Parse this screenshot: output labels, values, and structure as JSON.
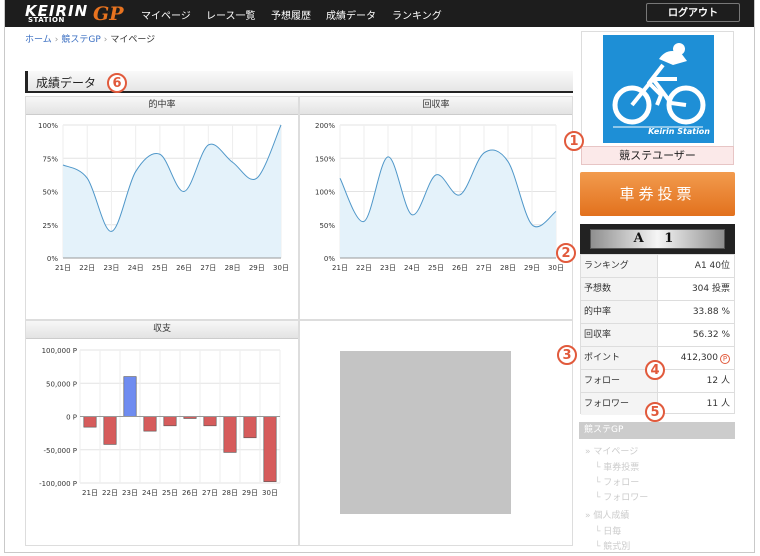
{
  "nav": {
    "logo_keirin": "KEIRIN",
    "logo_station": "STATION",
    "logo_gp": "GP",
    "items": [
      "マイページ",
      "レース一覧",
      "予想履歴",
      "成績データ",
      "ランキング"
    ],
    "logout": "ログアウト"
  },
  "breadcrumb": {
    "home": "ホーム",
    "section": "競ステGP",
    "current": "マイページ"
  },
  "section": {
    "title": "成績データ"
  },
  "badges": [
    "1",
    "2",
    "3",
    "4",
    "5",
    "6"
  ],
  "charts": {
    "hit": {
      "title": "的中率"
    },
    "recovery": {
      "title": "回収率"
    },
    "balance": {
      "title": "収支"
    }
  },
  "chart_data": [
    {
      "type": "area",
      "title": "的中率",
      "x": [
        "21日",
        "22日",
        "23日",
        "24日",
        "25日",
        "26日",
        "27日",
        "28日",
        "29日",
        "30日"
      ],
      "values": [
        70,
        60,
        20,
        65,
        78,
        50,
        85,
        72,
        60,
        100
      ],
      "ylim": [
        0,
        100
      ],
      "yticks": [
        "0%",
        "25%",
        "50%",
        "75%",
        "100%"
      ],
      "colors": {
        "line": "#4f97c9",
        "fill": "#e4f2fa"
      },
      "grid": true
    },
    {
      "type": "area",
      "title": "回収率",
      "x": [
        "21日",
        "22日",
        "23日",
        "24日",
        "25日",
        "26日",
        "27日",
        "28日",
        "29日",
        "30日"
      ],
      "values": [
        120,
        55,
        152,
        65,
        125,
        95,
        158,
        145,
        50,
        70
      ],
      "ylim": [
        0,
        200
      ],
      "yticks": [
        "0%",
        "50%",
        "100%",
        "150%",
        "200%"
      ],
      "colors": {
        "line": "#4f97c9",
        "fill": "#e4f2fa"
      },
      "grid": true
    },
    {
      "type": "bar",
      "title": "収支",
      "categories": [
        "21日",
        "22日",
        "23日",
        "24日",
        "25日",
        "26日",
        "27日",
        "28日",
        "29日",
        "30日"
      ],
      "values": [
        -16000,
        -42000,
        60000,
        -22000,
        -14000,
        -3000,
        -14000,
        -54000,
        -32000,
        -98000
      ],
      "ylim": [
        -100000,
        100000
      ],
      "yticks": [
        "-100,000 P",
        "-50,000 P",
        "0 P",
        "50,000 P",
        "100,000 P"
      ],
      "colors": {
        "positive": "#6f8cf0",
        "negative": "#d65c5c"
      },
      "grid": true
    }
  ],
  "sidebar": {
    "station_text": "Keirin Station",
    "username": "競ステユーザー",
    "ticket_button": "車券投票",
    "rank": "A 1",
    "stats": [
      {
        "label": "ランキング",
        "value": "A1 40位"
      },
      {
        "label": "予想数",
        "value": "304 投票"
      },
      {
        "label": "的中率",
        "value": "33.88 %"
      },
      {
        "label": "回収率",
        "value": "56.32 %"
      },
      {
        "label": "ポイント",
        "value": "412,300"
      },
      {
        "label": "フォロー",
        "value": "12 人"
      },
      {
        "label": "フォロワー",
        "value": "11 人"
      }
    ],
    "point_icon": "P",
    "menu_title": "競ステGP",
    "menu": [
      "マイページ",
      "車券投票",
      "フォロー",
      "フォロワー",
      "個人成績",
      "日毎",
      "競式別"
    ]
  },
  "colors": {
    "accent": "#e8731f",
    "badge": "#e15a3c",
    "nav_bg": "#1d1d1d"
  }
}
